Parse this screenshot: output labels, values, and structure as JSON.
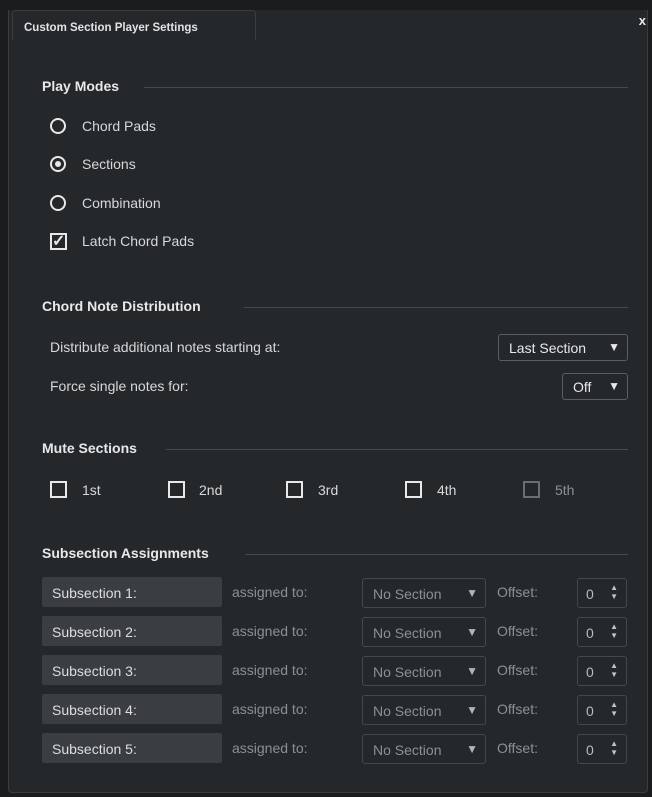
{
  "window": {
    "tab_title": "Custom Section Player Settings",
    "close_label": "x"
  },
  "play_modes": {
    "title": "Play Modes",
    "options": [
      {
        "label": "Chord Pads",
        "selected": false
      },
      {
        "label": "Sections",
        "selected": true
      },
      {
        "label": "Combination",
        "selected": false
      }
    ],
    "latch": {
      "label": "Latch Chord Pads",
      "checked": true
    }
  },
  "chord_note_distribution": {
    "title": "Chord Note Distribution",
    "distribute_label": "Distribute additional notes starting at:",
    "distribute_value": "Last Section",
    "force_label": "Force single notes for:",
    "force_value": "Off"
  },
  "mute_sections": {
    "title": "Mute Sections",
    "items": [
      {
        "label": "1st",
        "checked": false,
        "enabled": true
      },
      {
        "label": "2nd",
        "checked": false,
        "enabled": true
      },
      {
        "label": "3rd",
        "checked": false,
        "enabled": true
      },
      {
        "label": "4th",
        "checked": false,
        "enabled": true
      },
      {
        "label": "5th",
        "checked": false,
        "enabled": false
      }
    ]
  },
  "subsection_assignments": {
    "title": "Subsection Assignments",
    "assigned_label": "assigned to:",
    "offset_label": "Offset:",
    "rows": [
      {
        "name": "Subsection 1:",
        "section": "No Section",
        "offset": "0"
      },
      {
        "name": "Subsection 2:",
        "section": "No Section",
        "offset": "0"
      },
      {
        "name": "Subsection 3:",
        "section": "No Section",
        "offset": "0"
      },
      {
        "name": "Subsection 4:",
        "section": "No Section",
        "offset": "0"
      },
      {
        "name": "Subsection 5:",
        "section": "No Section",
        "offset": "0"
      }
    ]
  },
  "icons": {
    "dropdown_arrow": "▼",
    "spin_up": "▲",
    "spin_down": "▼",
    "check": "✓"
  }
}
